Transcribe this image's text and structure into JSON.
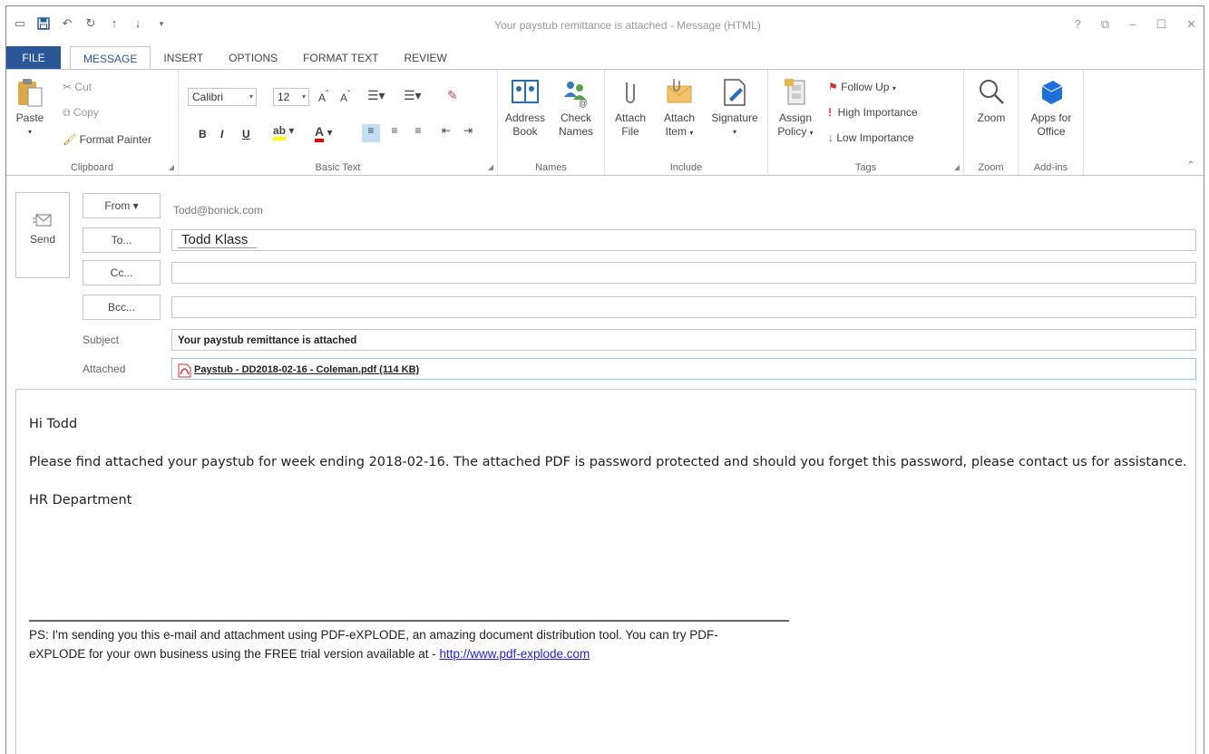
{
  "window": {
    "title": "Your paystub remittance is attached - Message (HTML)",
    "controls": [
      "?",
      "⧉",
      "–",
      "☐",
      "✕"
    ]
  },
  "tabs": [
    {
      "label": "FILE"
    },
    {
      "label": "MESSAGE"
    },
    {
      "label": "INSERT"
    },
    {
      "label": "OPTIONS"
    },
    {
      "label": "FORMAT TEXT"
    },
    {
      "label": "REVIEW"
    }
  ],
  "ribbon": {
    "clipboard": {
      "label": "Clipboard",
      "paste": "Paste",
      "cut": "Cut",
      "copy": "Copy",
      "format_painter": "Format Painter"
    },
    "basic_text": {
      "label": "Basic Text",
      "font": "Calibri",
      "size": "12",
      "bold": "B",
      "italic": "I",
      "underline": "U"
    },
    "names": {
      "label": "Names",
      "address_book": "Address Book",
      "check_names": "Check Names"
    },
    "include": {
      "label": "Include",
      "attach_file": "Attach File",
      "attach_item": "Attach Item",
      "signature": "Signature"
    },
    "tags": {
      "label": "Tags",
      "assign_policy": "Assign Policy",
      "follow_up": "Follow Up",
      "high_importance": "High Importance",
      "low_importance": "Low Importance"
    },
    "zoom": {
      "label": "Zoom",
      "zoom": "Zoom"
    },
    "addins": {
      "label": "Add-ins",
      "apps_for_office": "Apps for Office"
    }
  },
  "compose": {
    "send": "Send",
    "from_button": "From ▾",
    "from_value": "Todd@bonick.com",
    "to_button": "To...",
    "to_value": "Todd Klass",
    "cc_button": "Cc...",
    "cc_value": "",
    "bcc_button": "Bcc...",
    "bcc_value": "",
    "subject_label": "Subject",
    "subject_value": "Your paystub remittance is attached",
    "attached_label": "Attached",
    "attachment": "Paystub - DD2018-02-16 - Coleman.pdf (114 KB)"
  },
  "message": {
    "greeting": "Hi Todd",
    "paragraph": "Please find attached your paystub for week ending 2018-02-16. The attached PDF is password protected and should you forget this password, please contact us for assistance.",
    "signoff": "HR Department",
    "ps_text": "PS: I'm sending you this e-mail and attachment using PDF-eXPLODE, an amazing document distribution tool. You can try PDF-eXPLODE for your own business using the FREE trial version available at - ",
    "ps_link": "http://www.pdf-explode.com"
  },
  "colors": {
    "accent": "#2b579a",
    "link": "#1f1fd6",
    "pdf_red": "#d0312d"
  }
}
